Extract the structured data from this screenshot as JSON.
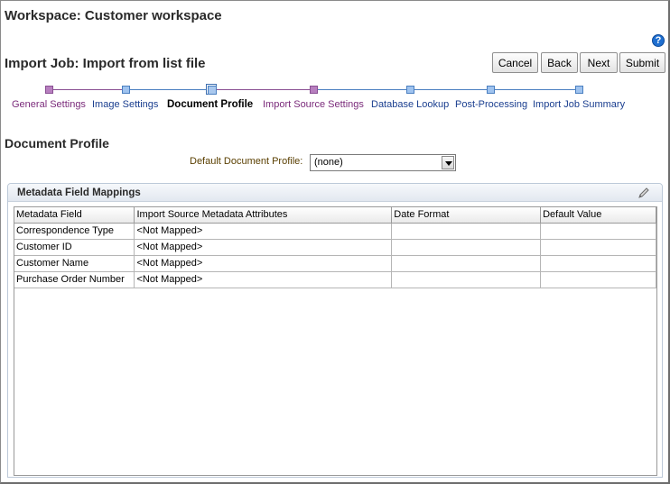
{
  "header": {
    "workspace_title": "Workspace: Customer workspace",
    "help_label": "?",
    "job_title": "Import Job: Import from list file"
  },
  "toolbar": {
    "cancel_label": "Cancel",
    "back_label": "Back",
    "next_label": "Next",
    "submit_label": "Submit"
  },
  "train": {
    "steps": [
      {
        "label": "General Settings",
        "state": "visited"
      },
      {
        "label": "Image Settings",
        "state": "unvisited"
      },
      {
        "label": "Document Profile",
        "state": "current"
      },
      {
        "label": "Import Source Settings",
        "state": "visited"
      },
      {
        "label": "Database Lookup",
        "state": "unvisited"
      },
      {
        "label": "Post-Processing",
        "state": "unvisited"
      },
      {
        "label": "Import Job Summary",
        "state": "unvisited"
      }
    ]
  },
  "document_profile": {
    "section_title": "Document Profile",
    "field_label": "Default Document Profile:",
    "selected_value": "(none)"
  },
  "mappings": {
    "panel_title": "Metadata Field Mappings",
    "columns": [
      "Metadata Field",
      "Import Source Metadata Attributes",
      "Date Format",
      "Default Value"
    ],
    "rows": [
      [
        "Correspondence Type",
        "<Not Mapped>",
        "",
        ""
      ],
      [
        "Customer ID",
        "<Not Mapped>",
        "",
        ""
      ],
      [
        "Customer Name",
        "<Not Mapped>",
        "",
        ""
      ],
      [
        "Purchase Order Number",
        "<Not Mapped>",
        "",
        ""
      ]
    ]
  },
  "colors": {
    "visited": "#7a2a7a",
    "unvisited": "#1a3e8f",
    "help_icon": "#1f6fd0"
  }
}
